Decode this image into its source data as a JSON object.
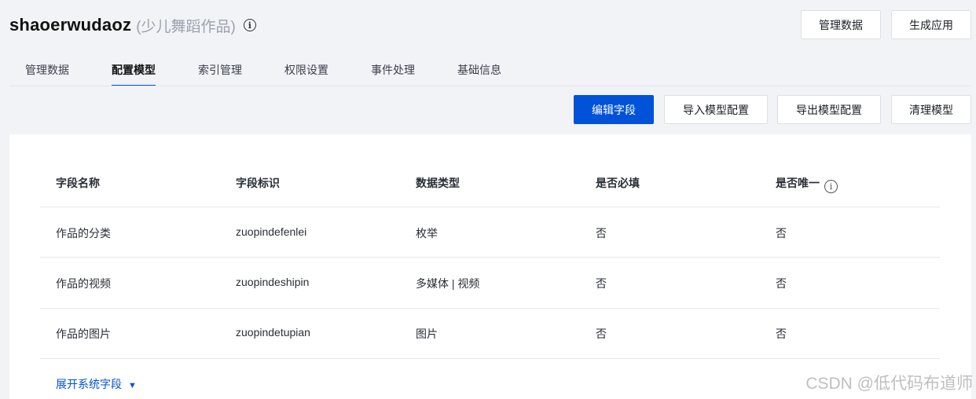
{
  "app": {
    "name": "shaoerwudaoz",
    "description": "(少儿舞蹈作品)"
  },
  "header_actions": {
    "manage_data": "管理数据",
    "generate_app": "生成应用"
  },
  "tabs": [
    {
      "label": "管理数据",
      "active": false
    },
    {
      "label": "配置模型",
      "active": true
    },
    {
      "label": "索引管理",
      "active": false
    },
    {
      "label": "权限设置",
      "active": false
    },
    {
      "label": "事件处理",
      "active": false
    },
    {
      "label": "基础信息",
      "active": false
    }
  ],
  "toolbar": {
    "edit_fields": "编辑字段",
    "import_config": "导入模型配置",
    "export_config": "导出模型配置",
    "clean_model": "清理模型"
  },
  "table": {
    "columns": [
      "字段名称",
      "字段标识",
      "数据类型",
      "是否必填",
      "是否唯一"
    ],
    "rows": [
      [
        "作品的分类",
        "zuopindefenlei",
        "枚举",
        "否",
        "否"
      ],
      [
        "作品的视频",
        "zuopindeshipin",
        "多媒体 | 视频",
        "否",
        "否"
      ],
      [
        "作品的图片",
        "zuopindetupian",
        "图片",
        "否",
        "否"
      ]
    ]
  },
  "expand_system_fields": "展开系统字段",
  "watermark": "CSDN @低代码布道师",
  "colors": {
    "primary": "#0052d9",
    "background": "#f2f3f7"
  }
}
